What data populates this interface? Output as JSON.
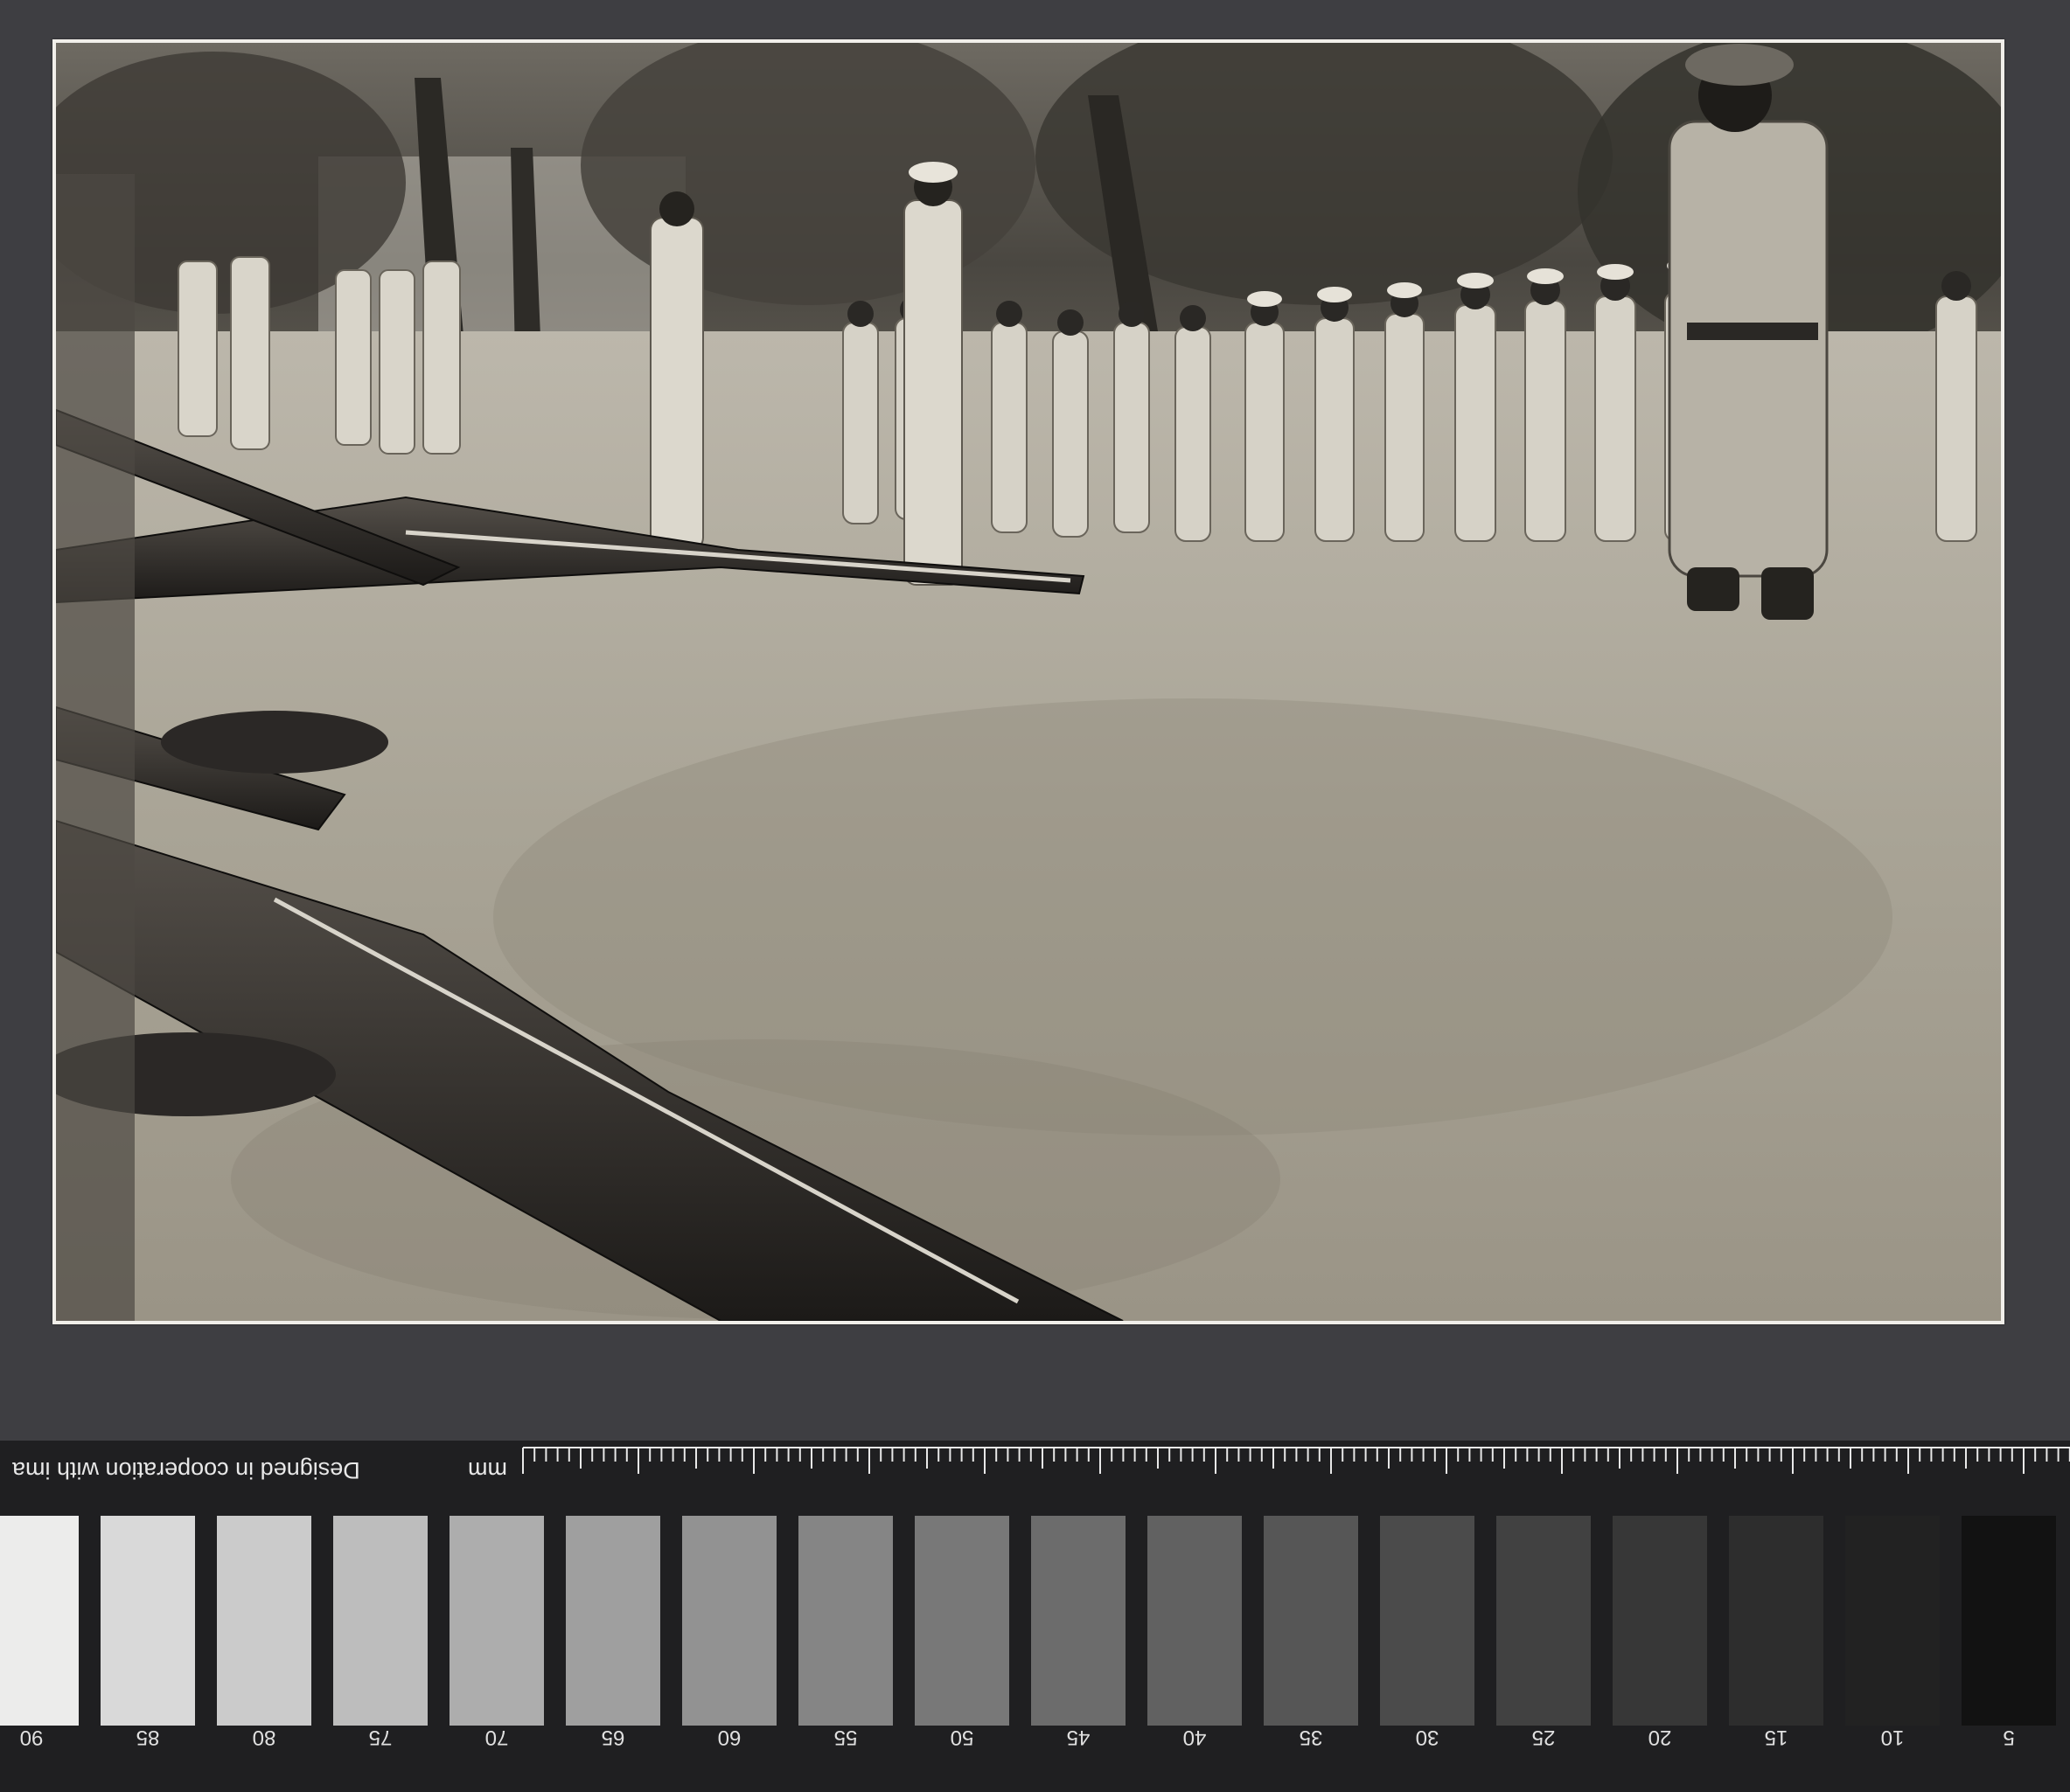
{
  "scale_target": {
    "text": "Designed in cooperation with ima",
    "unit": "mm",
    "patches": [
      {
        "label": "90",
        "color": "#ececeb"
      },
      {
        "label": "85",
        "color": "#d9d9d9"
      },
      {
        "label": "80",
        "color": "#cbcbcb"
      },
      {
        "label": "75",
        "color": "#bdbdbd"
      },
      {
        "label": "70",
        "color": "#adadad"
      },
      {
        "label": "65",
        "color": "#9f9f9f"
      },
      {
        "label": "60",
        "color": "#929292"
      },
      {
        "label": "55",
        "color": "#858585"
      },
      {
        "label": "50",
        "color": "#787878"
      },
      {
        "label": "45",
        "color": "#6c6c6c"
      },
      {
        "label": "40",
        "color": "#616161"
      },
      {
        "label": "35",
        "color": "#565656"
      },
      {
        "label": "30",
        "color": "#4b4b4b"
      },
      {
        "label": "25",
        "color": "#414141"
      },
      {
        "label": "20",
        "color": "#373737"
      },
      {
        "label": "15",
        "color": "#2d2d2d"
      },
      {
        "label": "10",
        "color": "#222222"
      },
      {
        "label": "5",
        "color": "#121212"
      }
    ]
  },
  "colors": {
    "background": "#3e3e42",
    "strip": "#1f1f21"
  }
}
